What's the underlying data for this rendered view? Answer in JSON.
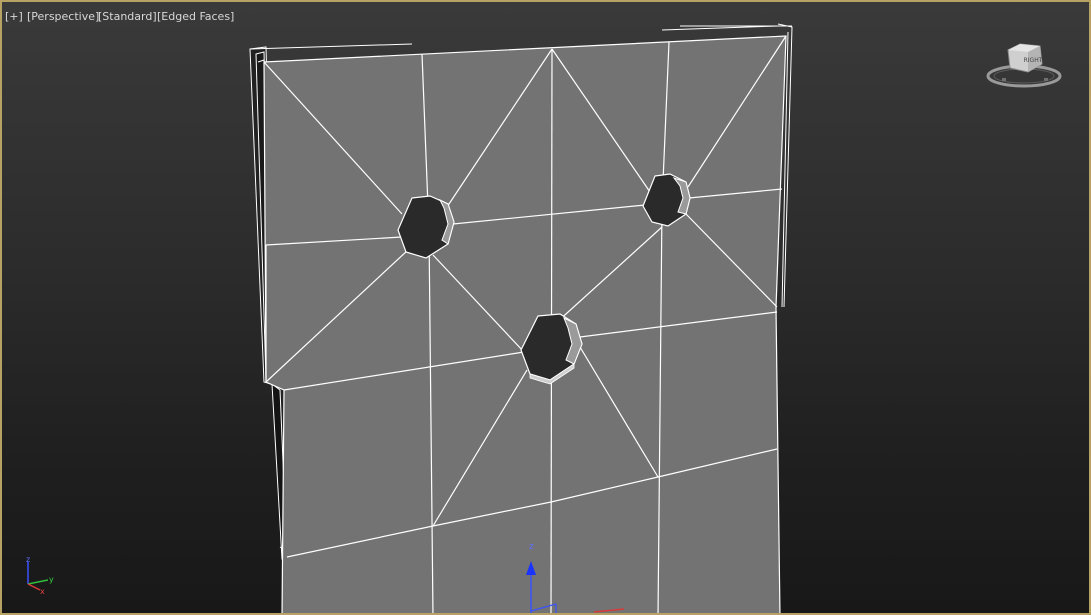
{
  "viewport": {
    "labels": {
      "plus_menu": "[+]",
      "view": "[Perspective]",
      "shading": "[Standard]",
      "display": "[Edged Faces]"
    },
    "viewcube_face": "RIGHT",
    "active_border_color": "#b6a364"
  },
  "axis_tripod": {
    "z": "z",
    "y": "y",
    "x": "x"
  },
  "gizmo": {
    "z": "z"
  },
  "scene": {
    "object": "wall panel with three octagonal holes",
    "face_color": "#737373",
    "hole_color": "#2a2a2a",
    "wire_color": "#ffffff"
  }
}
